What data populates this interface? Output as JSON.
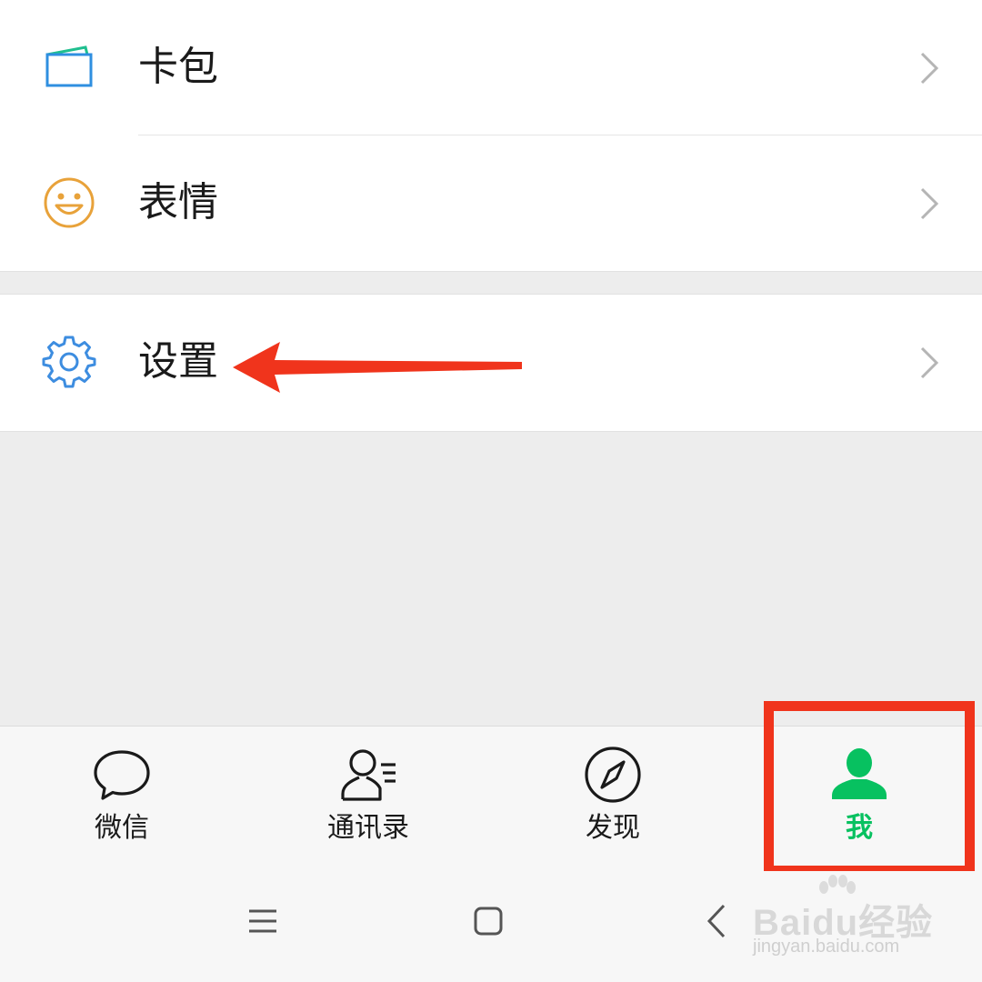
{
  "menu": {
    "card_wallet": "卡包",
    "stickers": "表情",
    "settings": "设置"
  },
  "tabbar": {
    "chats": "微信",
    "contacts": "通讯录",
    "discover": "发现",
    "me": "我"
  },
  "watermark": {
    "brand": "Baidu经验",
    "url": "jingyan.baidu.com"
  },
  "colors": {
    "accent_green": "#07c160",
    "annotation_red": "#f0341c",
    "settings_blue": "#3d8de0",
    "sticker_orange": "#e8a23a"
  }
}
